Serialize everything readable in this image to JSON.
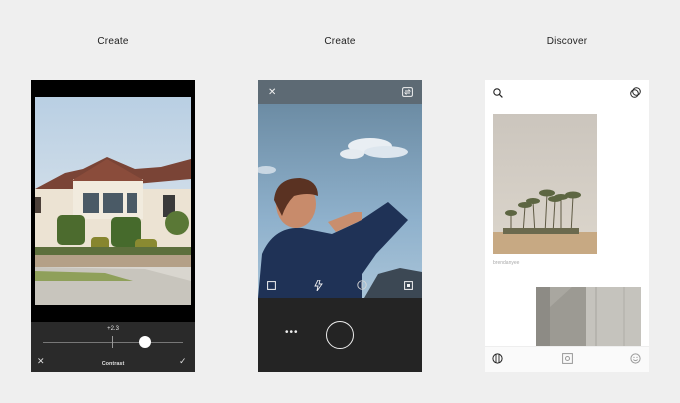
{
  "panels": [
    {
      "caption": "Create",
      "edit_value": "+2.3",
      "tool_label": "Contrast",
      "slider_value": 0.73
    },
    {
      "caption": "Create"
    },
    {
      "caption": "Discover",
      "username": "brendanyee"
    }
  ]
}
